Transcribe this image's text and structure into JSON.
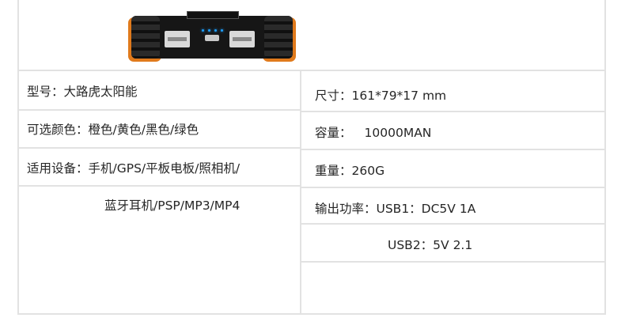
{
  "specs": {
    "model_label": "型号：大路虎太阳能",
    "colors_label": "可选颜色：橙色/黄色/黑色/绿色",
    "usage_line1": "适用设备：手机/GPS/平板电板/照相机/",
    "usage_line2": "蓝牙耳机/PSP/MP3/MP4",
    "size_label": "尺寸：161*79*17 mm",
    "capacity_label": "容量：",
    "capacity_value": "10000MAN",
    "weight_label": "重量：260G",
    "output_line1": "输出功率：USB1：DC5V 1A",
    "output_line2": "USB2：5V  2.1"
  },
  "colors": {
    "border": "#e2e2e2",
    "device_orange": "#e07a1c",
    "led_blue": "#1ea0ff"
  }
}
